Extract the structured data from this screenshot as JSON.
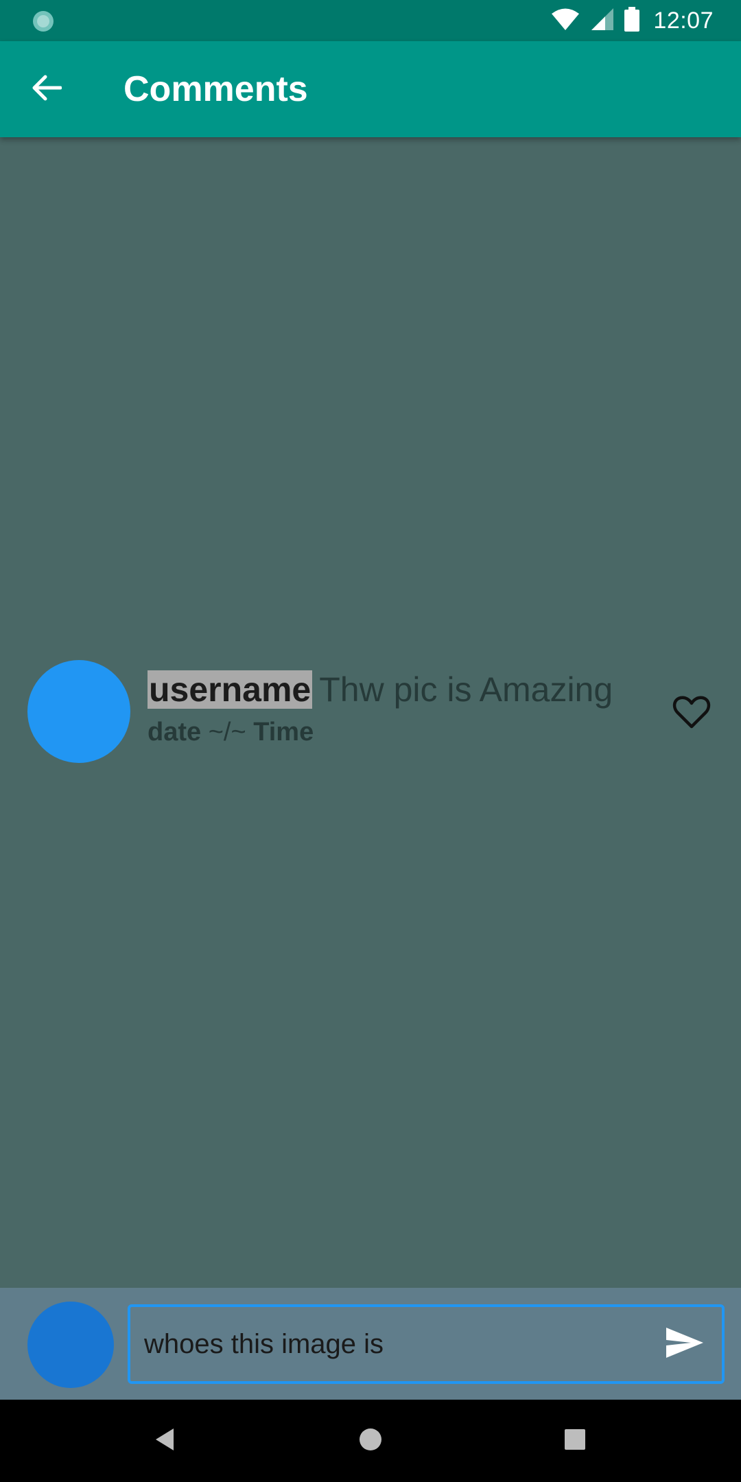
{
  "status_bar": {
    "time": "12:07",
    "icons": [
      "sync-icon",
      "wifi-icon",
      "signal-icon",
      "battery-icon"
    ]
  },
  "app_bar": {
    "title": "Comments",
    "back_icon": "arrow-back-icon"
  },
  "comment": {
    "username": "username",
    "text": "Thw pic is Amazing",
    "date": "date",
    "separator": "~/~",
    "time": "Time",
    "like_icon": "heart-outline-icon"
  },
  "composer": {
    "value": "whoes this image is",
    "send_icon": "send-icon"
  },
  "nav_bar": {
    "icons": [
      "back-triangle-icon",
      "home-circle-icon",
      "recents-square-icon"
    ]
  },
  "colors": {
    "status_bar": "#00796b",
    "app_bar": "#009688",
    "background": "#4a6866",
    "comment_avatar": "#2196f3",
    "composer_bar": "#607d8b",
    "input_border": "#2196f3",
    "composer_avatar": "#1976d2"
  }
}
